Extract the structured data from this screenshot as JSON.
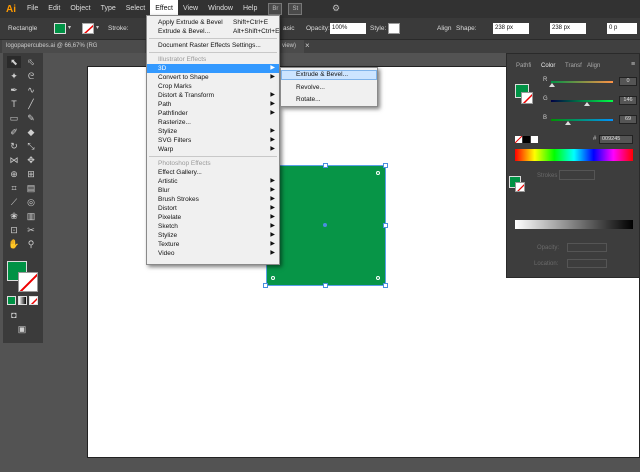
{
  "app": {
    "logo": "Ai"
  },
  "menubar": {
    "items": [
      "File",
      "Edit",
      "Object",
      "Type",
      "Select",
      "Effect",
      "View",
      "Window",
      "Help"
    ],
    "badges": [
      "Br",
      "St"
    ]
  },
  "controlbar": {
    "selection_label": "Rectangle",
    "stroke_label": "Stroke:",
    "basic_label": "asic",
    "opacity_label": "Opacity:",
    "opacity_value": "100%",
    "style_label": "Style:",
    "align_label": "Align",
    "shape_label": "Shape:",
    "width_value": "238 px",
    "height_value": "238 px",
    "extra_value": "0 p"
  },
  "tabbar": {
    "doc_tab": "logopapercubes.ai @ 66,67% (RG",
    "view_tab_suffix": "view)",
    "close_icon": "×"
  },
  "effect_menu": {
    "apply_label": "Apply Extrude & Bevel",
    "apply_shortcut": "Shift+Ctrl+E",
    "extrude_label": "Extrude & Bevel...",
    "extrude_shortcut": "Alt+Shift+Ctrl+E",
    "raster_settings": "Document Raster Effects Settings...",
    "illustrator_header": "Illustrator Effects",
    "illustrator_items": [
      "3D",
      "Convert to Shape",
      "Crop Marks",
      "Distort & Transform",
      "Path",
      "Pathfinder",
      "Rasterize...",
      "Stylize",
      "SVG Filters",
      "Warp"
    ],
    "photoshop_header": "Photoshop Effects",
    "photoshop_items": [
      "Effect Gallery...",
      "Artistic",
      "Blur",
      "Brush Strokes",
      "Distort",
      "Pixelate",
      "Sketch",
      "Stylize",
      "Texture",
      "Video"
    ]
  },
  "submenu_3d": {
    "items": [
      "Extrude & Bevel...",
      "Revolve...",
      "Rotate..."
    ]
  },
  "color_panel": {
    "tabs": [
      "Pathfi",
      "Color",
      "Transf",
      "Align"
    ],
    "r_label": "R",
    "r_value": "0",
    "g_label": "G",
    "g_value": "146",
    "b_label": "B",
    "b_value": "69",
    "hex_label": "#",
    "hex_value": "009245",
    "strokes_label": "Strokes",
    "opacity_label": "Opacity:",
    "location_label": "Location:"
  },
  "colors": {
    "fill": "#009245",
    "menu_highlight": "#3399ff",
    "selection": "#4a8ee0"
  }
}
